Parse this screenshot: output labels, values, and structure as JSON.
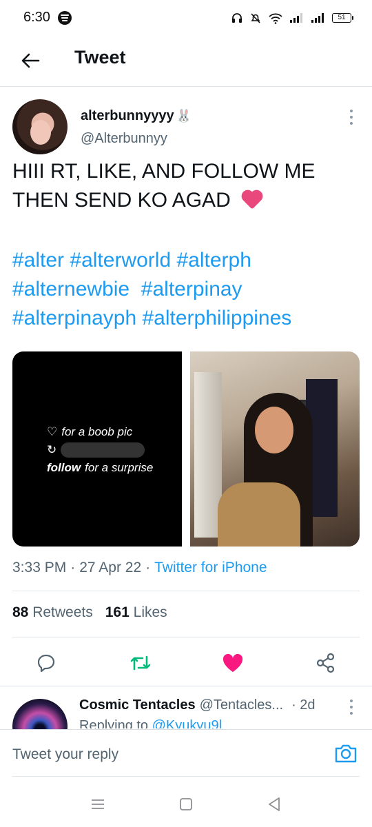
{
  "status_bar": {
    "time": "6:30",
    "battery": "51"
  },
  "header": {
    "title": "Tweet"
  },
  "tweet": {
    "display_name": "alterbunnyyyy",
    "name_emoji": "🐰",
    "handle": "@Alterbunnyy",
    "text_line1": "HIII RT, LIKE, AND FOLLOW ME",
    "text_line2": "THEN SEND KO AGAD",
    "hashtags": [
      "#alter",
      "#alterworld",
      "#alterph",
      "#alternewbie",
      "#alterpinay",
      "#alterpinayph",
      "#alterphilippines"
    ],
    "media_text": {
      "line1_icon": "♡",
      "line1": "for a boob pic",
      "line2_icon": "↻",
      "line3_bold": "follow",
      "line3": "for a surprise"
    },
    "time": "3:33 PM",
    "date": "27 Apr 22",
    "source": "Twitter for iPhone",
    "retweets_count": "88",
    "retweets_label": "Retweets",
    "likes_count": "161",
    "likes_label": "Likes"
  },
  "reply": {
    "name": "Cosmic Tentacles",
    "handle": "@Tentacles...",
    "age": "· 2d",
    "replying_prefix": "Replying to",
    "replying_to": "@Kyukyu9l"
  },
  "composer": {
    "placeholder": "Tweet your reply"
  },
  "colors": {
    "accent": "#1d9bf0",
    "retweet": "#00ba7c",
    "like": "#f91880"
  },
  "icons": [
    "back-arrow-icon",
    "more-icon",
    "reply-icon",
    "retweet-icon",
    "like-icon",
    "share-icon",
    "camera-icon",
    "menu-icon",
    "home-icon",
    "back-nav-icon"
  ]
}
